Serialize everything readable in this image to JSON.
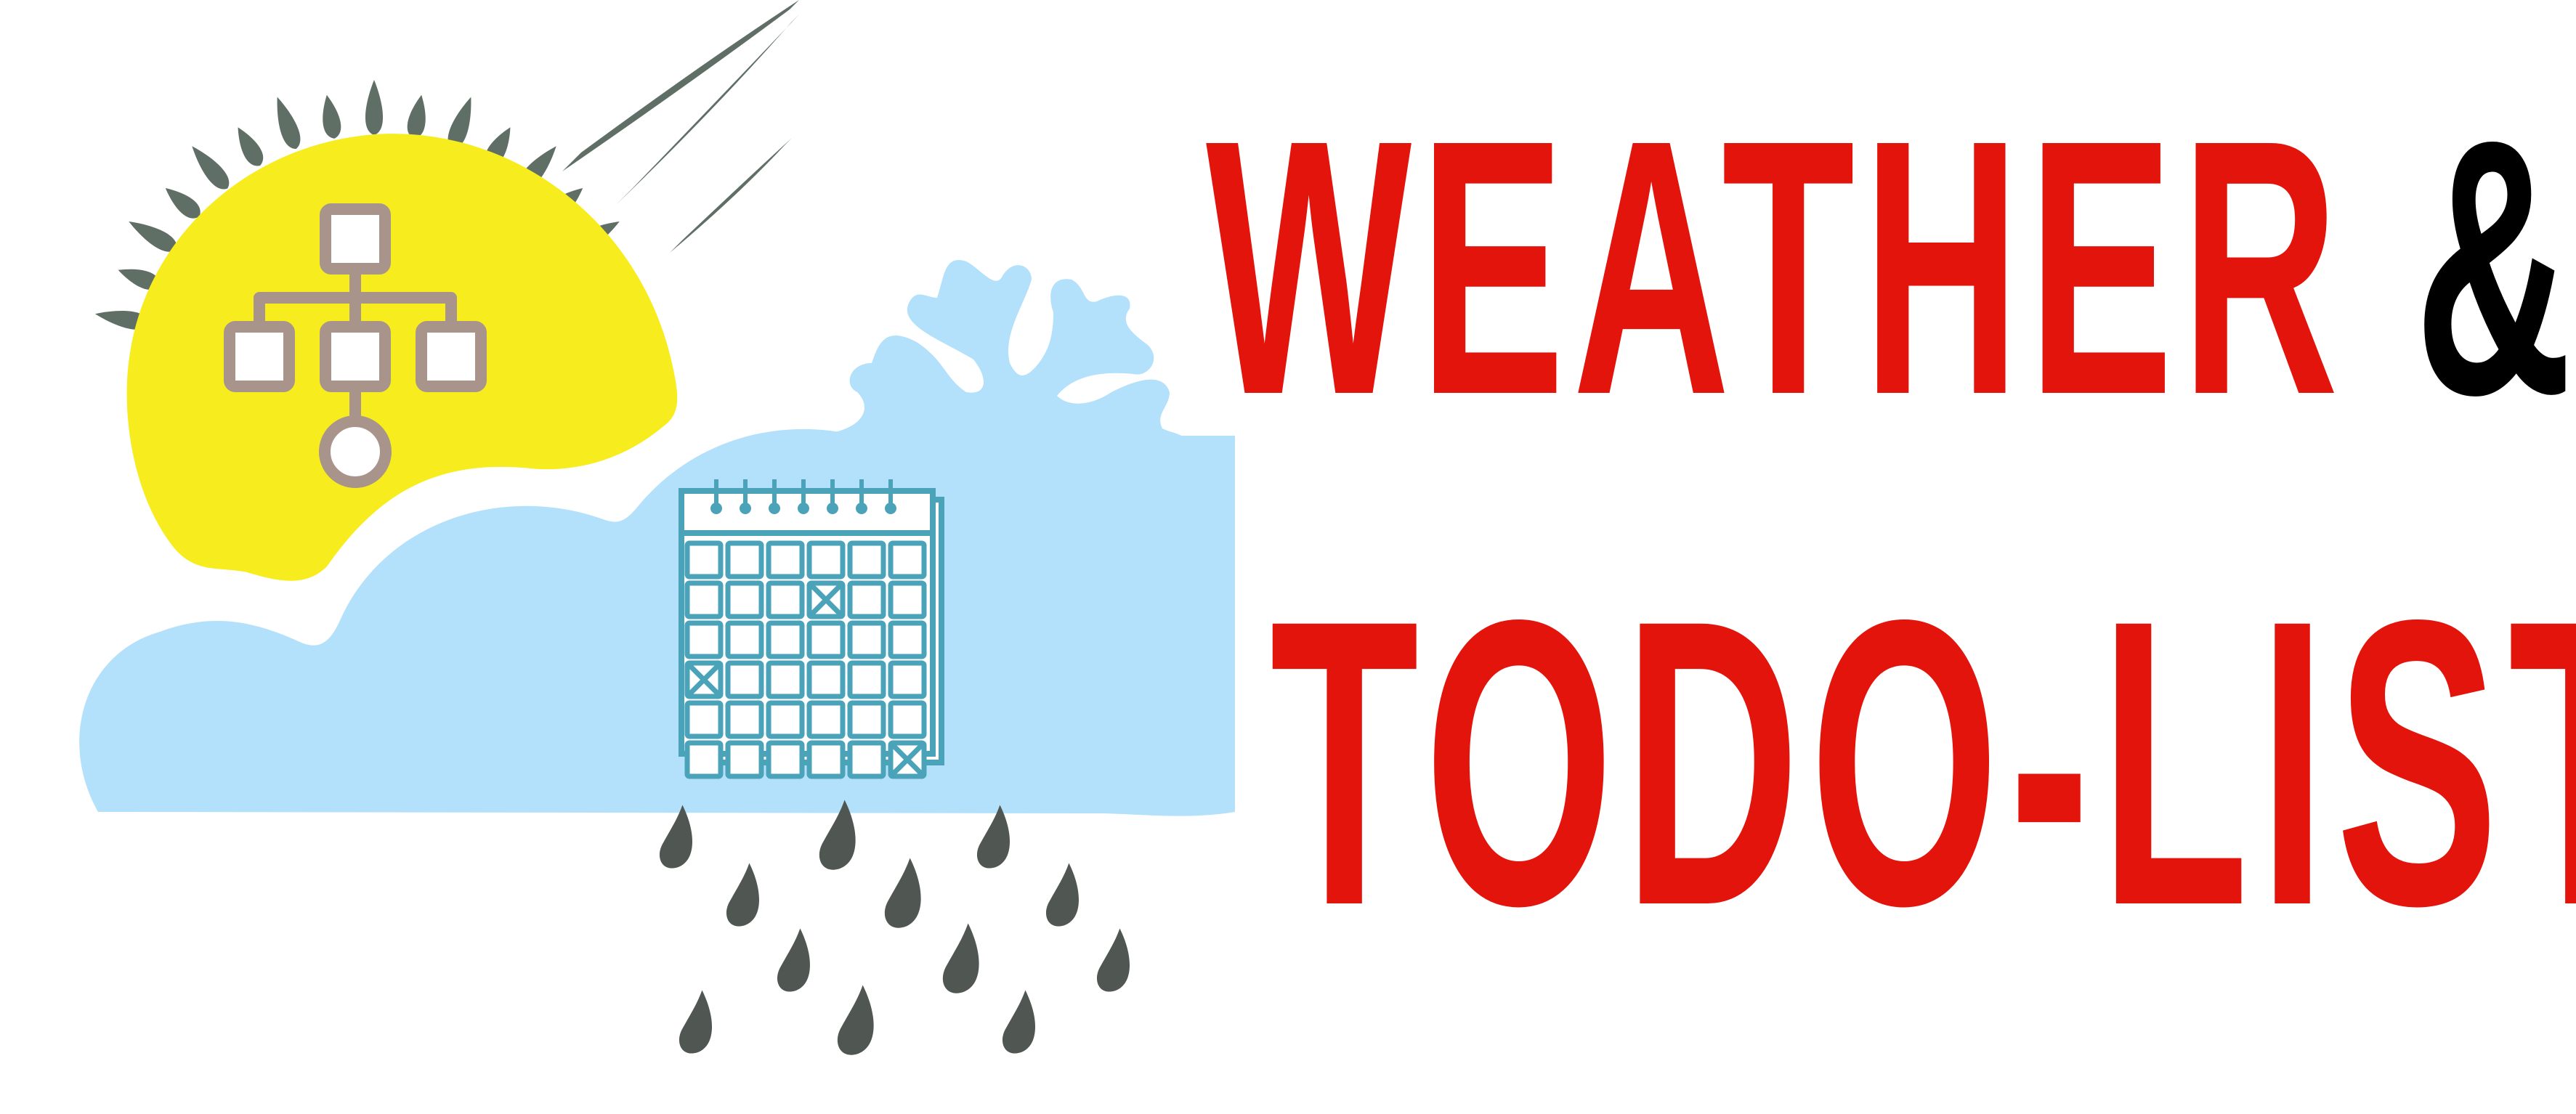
{
  "title": {
    "line1": "WEATHER ",
    "ampersand": "&",
    "line2": "TODO-LIST"
  },
  "colors": {
    "title_red": "#e3140c",
    "title_black": "#000000",
    "sun_yellow": "#f7ec1e",
    "cloud_blue": "#b3e0fa",
    "ray_gray": "#5f6f66",
    "drop_gray": "#505651",
    "calendar_teal": "#4aa3b8",
    "org_chart_taupe": "#a8948a"
  },
  "icons": {
    "logo": "weather-todo-logo",
    "sun": "sun-icon",
    "cloud": "cloud-icon",
    "snowflake": "snowflake-icon",
    "rain": "rain-drops-icon",
    "org_chart": "org-chart-icon",
    "calendar": "calendar-icon"
  }
}
